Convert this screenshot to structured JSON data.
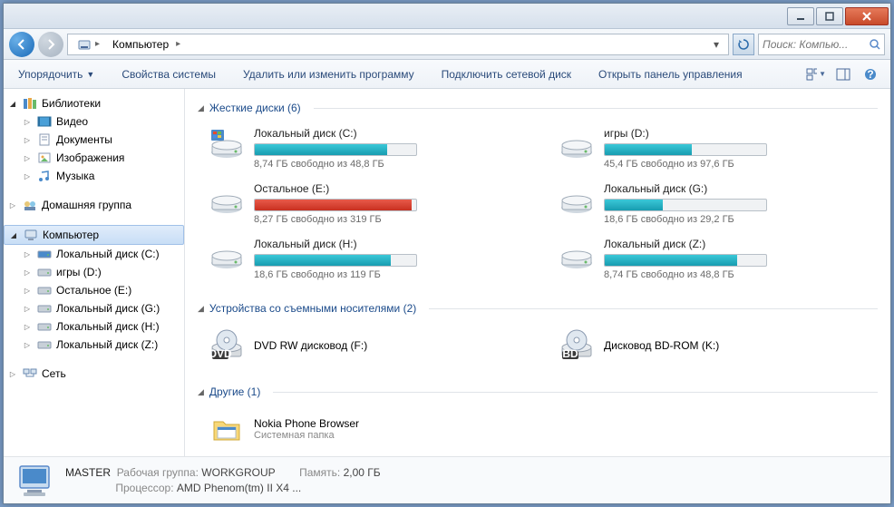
{
  "breadcrumb": {
    "root": "Компьютер"
  },
  "search": {
    "placeholder": "Поиск: Компью..."
  },
  "toolbar": {
    "organize": "Упорядочить",
    "system_props": "Свойства системы",
    "uninstall": "Удалить или изменить программу",
    "map_drive": "Подключить сетевой диск",
    "control_panel": "Открыть панель управления"
  },
  "sidebar": {
    "libraries": "Библиотеки",
    "video": "Видео",
    "documents": "Документы",
    "pictures": "Изображения",
    "music": "Музыка",
    "homegroup": "Домашняя группа",
    "computer": "Компьютер",
    "drives": [
      "Локальный диск (C:)",
      "игры (D:)",
      "Остальное (E:)",
      "Локальный диск (G:)",
      "Локальный диск (H:)",
      "Локальный диск (Z:)"
    ],
    "network": "Сеть"
  },
  "groups": {
    "hdd": "Жесткие диски (6)",
    "removable": "Устройства со съемными носителями (2)",
    "other": "Другие (1)"
  },
  "drives": [
    {
      "name": "Локальный диск (C:)",
      "status": "8,74 ГБ свободно из 48,8 ГБ",
      "pct": 82,
      "red": false,
      "os": true
    },
    {
      "name": "игры (D:)",
      "status": "45,4 ГБ свободно из 97,6 ГБ",
      "pct": 54,
      "red": false,
      "os": false
    },
    {
      "name": "Остальное (E:)",
      "status": "8,27 ГБ свободно из 319 ГБ",
      "pct": 97,
      "red": true,
      "os": false
    },
    {
      "name": "Локальный диск (G:)",
      "status": "18,6 ГБ свободно из 29,2 ГБ",
      "pct": 36,
      "red": false,
      "os": false
    },
    {
      "name": "Локальный диск (H:)",
      "status": "18,6 ГБ свободно из 119 ГБ",
      "pct": 84,
      "red": false,
      "os": false
    },
    {
      "name": "Локальный диск (Z:)",
      "status": "8,74 ГБ свободно из 48,8 ГБ",
      "pct": 82,
      "red": false,
      "os": false
    }
  ],
  "removable": [
    {
      "name": "DVD RW дисковод (F:)",
      "badge": "DVD"
    },
    {
      "name": "Дисковод BD-ROM (K:)",
      "badge": "BD"
    }
  ],
  "other": [
    {
      "name": "Nokia Phone Browser",
      "sub": "Системная папка"
    }
  ],
  "status": {
    "name": "MASTER",
    "workgroup_k": "Рабочая группа:",
    "workgroup_v": "WORKGROUP",
    "memory_k": "Память:",
    "memory_v": "2,00 ГБ",
    "cpu_k": "Процессор:",
    "cpu_v": "AMD Phenom(tm) II X4 ..."
  }
}
